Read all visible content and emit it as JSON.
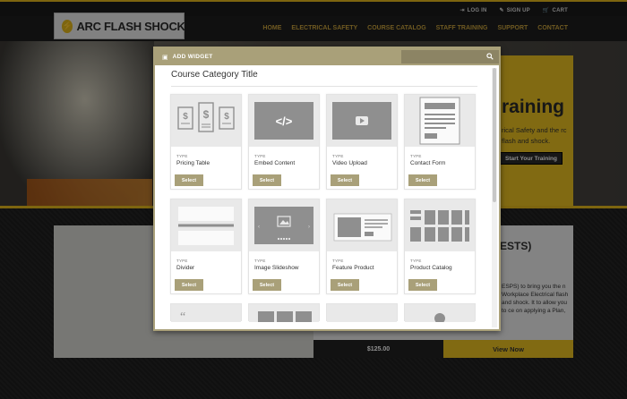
{
  "site": {
    "logo_text": "ARC FLASH SHOCK",
    "top_links": [
      {
        "icon": "login-icon",
        "glyph": "⇥",
        "label": "LOG IN"
      },
      {
        "icon": "pencil-icon",
        "glyph": "✎",
        "label": "SIGN UP"
      },
      {
        "icon": "cart-icon",
        "glyph": "🛒",
        "label": "CART"
      }
    ],
    "nav": [
      "HOME",
      "ELECTRICAL SAFETY",
      "COURSE CATALOG",
      "STAFF TRAINING",
      "SUPPORT",
      "CONTACT"
    ],
    "hero_title_fragment": "raining",
    "hero_text_fragment": "rical Safety and the rc flash and shock.",
    "hero_button": "Start Your Training",
    "lower_heading_fragment": "ESTS)",
    "lower_text_fragment": "ESPS) to bring you the n Workplace Electrical flash and shock. It to allow you to ce on applying a Plan,",
    "price": "$125.00",
    "view_button": "View Now",
    "accent_color": "#e3b91c"
  },
  "modal": {
    "title": "ADD WIDGET",
    "search_placeholder": "",
    "category_title": "Course Category Title",
    "type_label": "TYPE",
    "select_label": "Select",
    "widgets": [
      {
        "name": "Pricing Table",
        "icon": "pricing-table-icon"
      },
      {
        "name": "Embed Content",
        "icon": "embed-code-icon"
      },
      {
        "name": "Video Upload",
        "icon": "video-icon"
      },
      {
        "name": "Contact Form",
        "icon": "form-icon"
      },
      {
        "name": "Divider",
        "icon": "divider-icon"
      },
      {
        "name": "Image Slideshow",
        "icon": "slideshow-icon"
      },
      {
        "name": "Feature Product",
        "icon": "feature-product-icon"
      },
      {
        "name": "Product Catalog",
        "icon": "catalog-grid-icon"
      }
    ],
    "header_color": "#a9a079"
  }
}
